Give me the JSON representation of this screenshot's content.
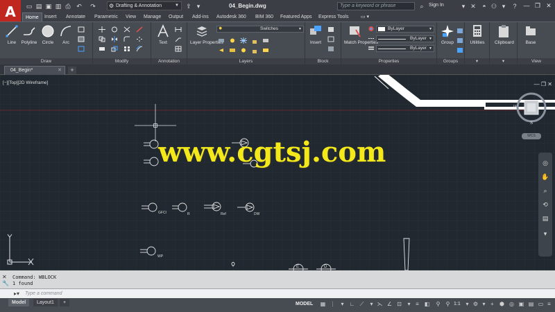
{
  "app": {
    "logo": "A",
    "workspace": "Drafting & Annotation",
    "document_title": "04_Begin.dwg",
    "search_placeholder": "Type a keyword or phrase",
    "sign_in": "Sign In"
  },
  "ribbon_tabs": [
    "Home",
    "Insert",
    "Annotate",
    "Parametric",
    "View",
    "Manage",
    "Output",
    "Add-ins",
    "Autodesk 360",
    "BIM 360",
    "Featured Apps",
    "Express Tools"
  ],
  "ribbon": {
    "draw": {
      "title": "Draw",
      "tools": [
        "Line",
        "Polyline",
        "Circle",
        "Arc"
      ]
    },
    "modify": {
      "title": "Modify"
    },
    "annotation": {
      "title": "Annotation",
      "text": "Text"
    },
    "layers": {
      "title": "Layers",
      "layer_properties": "Layer Properties",
      "current_layer": "Switches"
    },
    "block": {
      "title": "Block",
      "insert": "Insert"
    },
    "properties": {
      "title": "Properties",
      "match": "Match Properties",
      "color": "ByLayer",
      "linetype": "ByLayer",
      "lineweight": "ByLayer"
    },
    "groups": {
      "title": "Groups",
      "group": "Group"
    },
    "utilities": {
      "label": "Utilities"
    },
    "clipboard": {
      "label": "Clipboard"
    },
    "view": {
      "title": "View",
      "base": "Base"
    }
  },
  "file_tab": "04_Begin*",
  "viewport_label": "[−][Top][2D Wireframe]",
  "viewcube": {
    "compass_w": "W",
    "compass_s": "S",
    "wcs": "WCS"
  },
  "watermark": "www.cgtsj.com",
  "symbol_labels": [
    "GFCI",
    "R",
    "Ref",
    "DW",
    "WP",
    "E",
    "D"
  ],
  "command": {
    "history": [
      "Command: WBLOCK",
      "1 found"
    ],
    "placeholder": "Type a command"
  },
  "layout_tabs": [
    "Model",
    "Layout1"
  ],
  "status": {
    "model": "MODEL",
    "scale": "1:1"
  },
  "colors": {
    "brand": "#c0281f",
    "watermark": "#f3e81a",
    "canvas": "#212830"
  }
}
